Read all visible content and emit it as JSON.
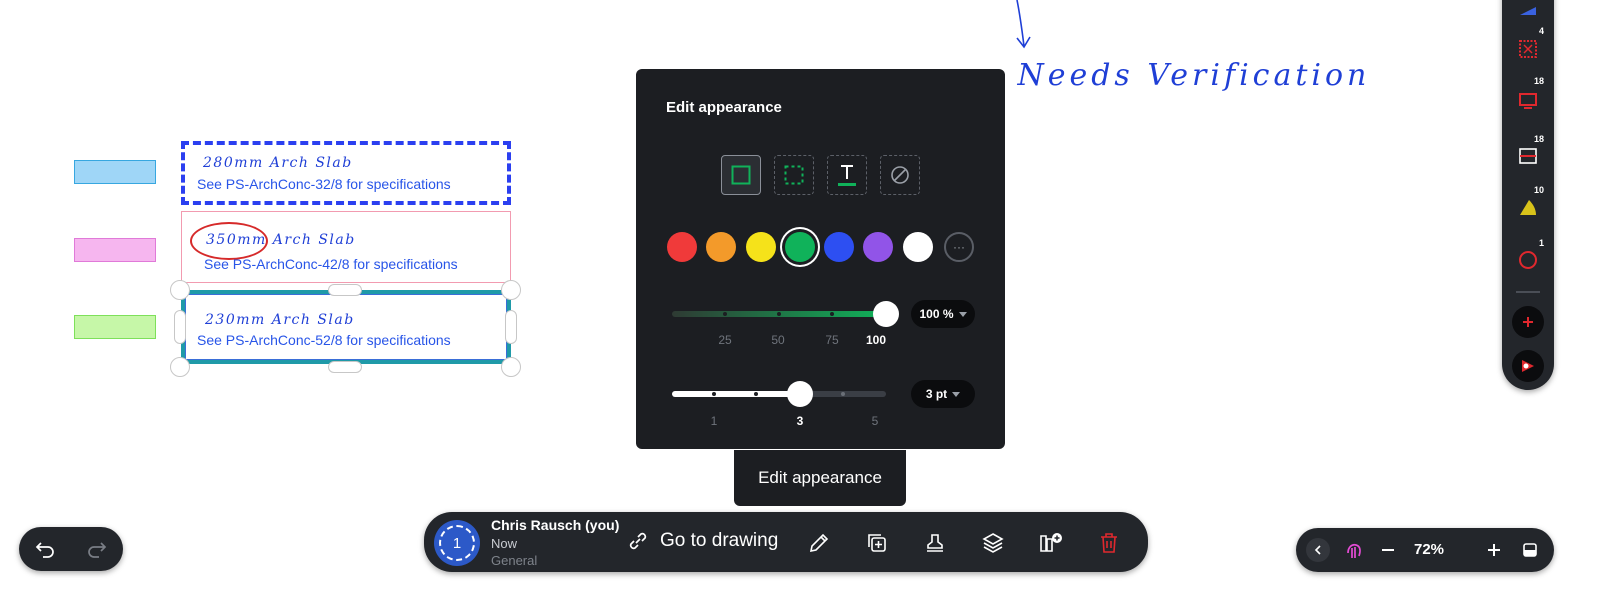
{
  "canvas": {
    "heading_text": "...n Needs Verification",
    "annotations": [
      {
        "mark": "280mm Arch Slab",
        "spec": "See PS-ArchConc-32/8 for specifications"
      },
      {
        "mark": "350mm Arch Slab",
        "spec": "See PS-ArchConc-42/8 for specifications"
      },
      {
        "mark": "230mm Arch Slab",
        "spec": "See PS-ArchConc-52/8 for specifications"
      }
    ],
    "swatch_colors": [
      "#9fd6f7",
      "#f6b6ef",
      "#c6f7a8"
    ]
  },
  "edit_panel": {
    "title": "Edit appearance",
    "style_options": [
      "solid-border",
      "dashed-border",
      "text-underline",
      "none"
    ],
    "colors": [
      {
        "name": "red",
        "hex": "#f03a3a"
      },
      {
        "name": "orange",
        "hex": "#f39a2a"
      },
      {
        "name": "yellow",
        "hex": "#f5e21a"
      },
      {
        "name": "green",
        "hex": "#10b25a",
        "selected": true
      },
      {
        "name": "blue",
        "hex": "#2d4ff2"
      },
      {
        "name": "purple",
        "hex": "#9154e8"
      },
      {
        "name": "white",
        "hex": "#ffffff"
      }
    ],
    "more_label": "···",
    "opacity": {
      "value": 100,
      "display": "100 %",
      "ticks": [
        "25",
        "50",
        "75",
        "100"
      ]
    },
    "thickness": {
      "value": 3,
      "display": "3 pt",
      "ticks": [
        "1",
        "3",
        "5"
      ]
    }
  },
  "tooltip": {
    "text": "Edit appearance"
  },
  "bottom_bar": {
    "avatar_number": "1",
    "user_name": "Chris Rausch (you)",
    "user_time": "Now",
    "user_group": "General",
    "goto_label": "Go to drawing"
  },
  "zoom_bar": {
    "zoom": "72%"
  },
  "right_toolbar": {
    "counts": [
      "4",
      "18",
      "18",
      "10",
      "1"
    ]
  }
}
